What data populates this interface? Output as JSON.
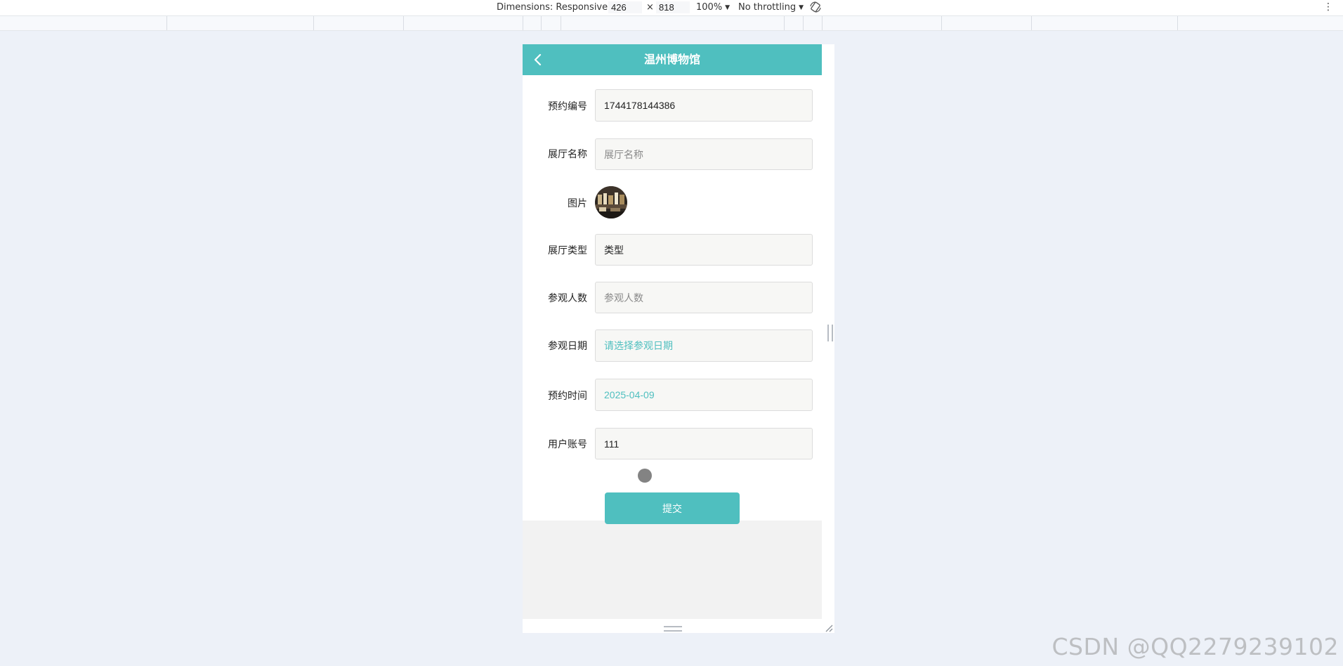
{
  "devtools": {
    "dimensions_label": "Dimensions: Responsive",
    "width_value": "426",
    "times_sign": "×",
    "height_value": "818",
    "zoom_label": "100%",
    "throttling_label": "No throttling"
  },
  "app": {
    "title": "温州博物馆"
  },
  "form": {
    "fields": [
      {
        "label": "预约编号",
        "value": "1744178144386",
        "placeholder": ""
      },
      {
        "label": "展厅名称",
        "value": "",
        "placeholder": "展厅名称"
      },
      {
        "label": "图片"
      },
      {
        "label": "展厅类型",
        "value": "类型",
        "placeholder": ""
      },
      {
        "label": "参观人数",
        "value": "",
        "placeholder": "参观人数"
      },
      {
        "label": "参观日期",
        "value": "请选择参观日期",
        "placeholder": ""
      },
      {
        "label": "预约时间",
        "value": "2025-04-09",
        "placeholder": ""
      },
      {
        "label": "用户账号",
        "value": "111",
        "placeholder": ""
      }
    ],
    "submit_label": "提交"
  },
  "colors": {
    "accent": "#4fbfbf",
    "page_background": "#edf1f8"
  },
  "watermark": "CSDN @QQ2279239102"
}
